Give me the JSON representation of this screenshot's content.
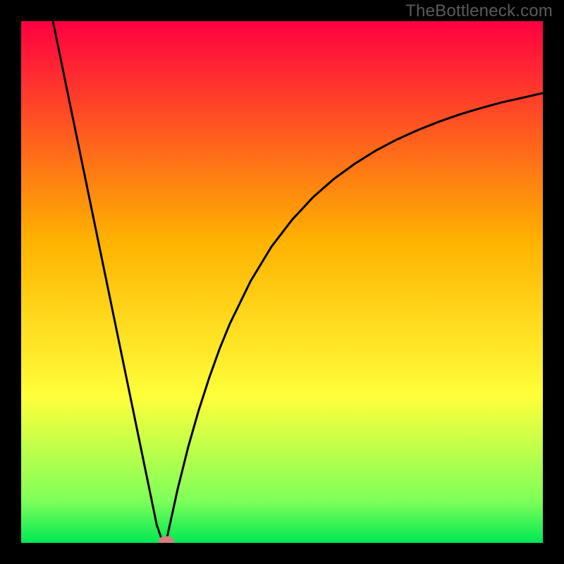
{
  "watermark": "TheBottleneck.com",
  "chart_data": {
    "type": "line",
    "title": "",
    "xlabel": "",
    "ylabel": "",
    "xlim": [
      0,
      100
    ],
    "ylim": [
      0,
      100
    ],
    "grid": false,
    "background": "rainbow-vertical-red-to-green",
    "curves": {
      "left": {
        "x": [
          6.1,
          8,
          10,
          12,
          14,
          16,
          18,
          20,
          22,
          24,
          26,
          27,
          27.8
        ],
        "y": [
          100,
          90.7,
          81.0,
          71.3,
          61.6,
          51.9,
          42.2,
          32.5,
          22.8,
          13.1,
          3.4,
          0.5,
          0.0
        ]
      },
      "right": {
        "x": [
          27.8,
          28,
          30,
          32,
          34,
          36,
          38,
          40,
          44,
          48,
          52,
          56,
          60,
          64,
          68,
          72,
          76,
          80,
          84,
          88,
          92,
          96,
          100
        ],
        "y": [
          0.0,
          1.2,
          10.3,
          18.3,
          25.3,
          31.5,
          37.1,
          42.0,
          50.2,
          56.8,
          62.0,
          66.3,
          69.8,
          72.7,
          75.2,
          77.3,
          79.1,
          80.7,
          82.1,
          83.3,
          84.4,
          85.3,
          86.2
        ]
      }
    },
    "marker": {
      "x": 27.8,
      "y": 0.0,
      "color": "#d77d7d"
    }
  },
  "colors": {
    "top": "#ff0040",
    "mid": "#ffb200",
    "yellow": "#ffff3a",
    "green_top": "#7eff5a",
    "green": "#00e852",
    "curve": "#000000",
    "marker": "#d77d7d",
    "frame": "#000000"
  }
}
